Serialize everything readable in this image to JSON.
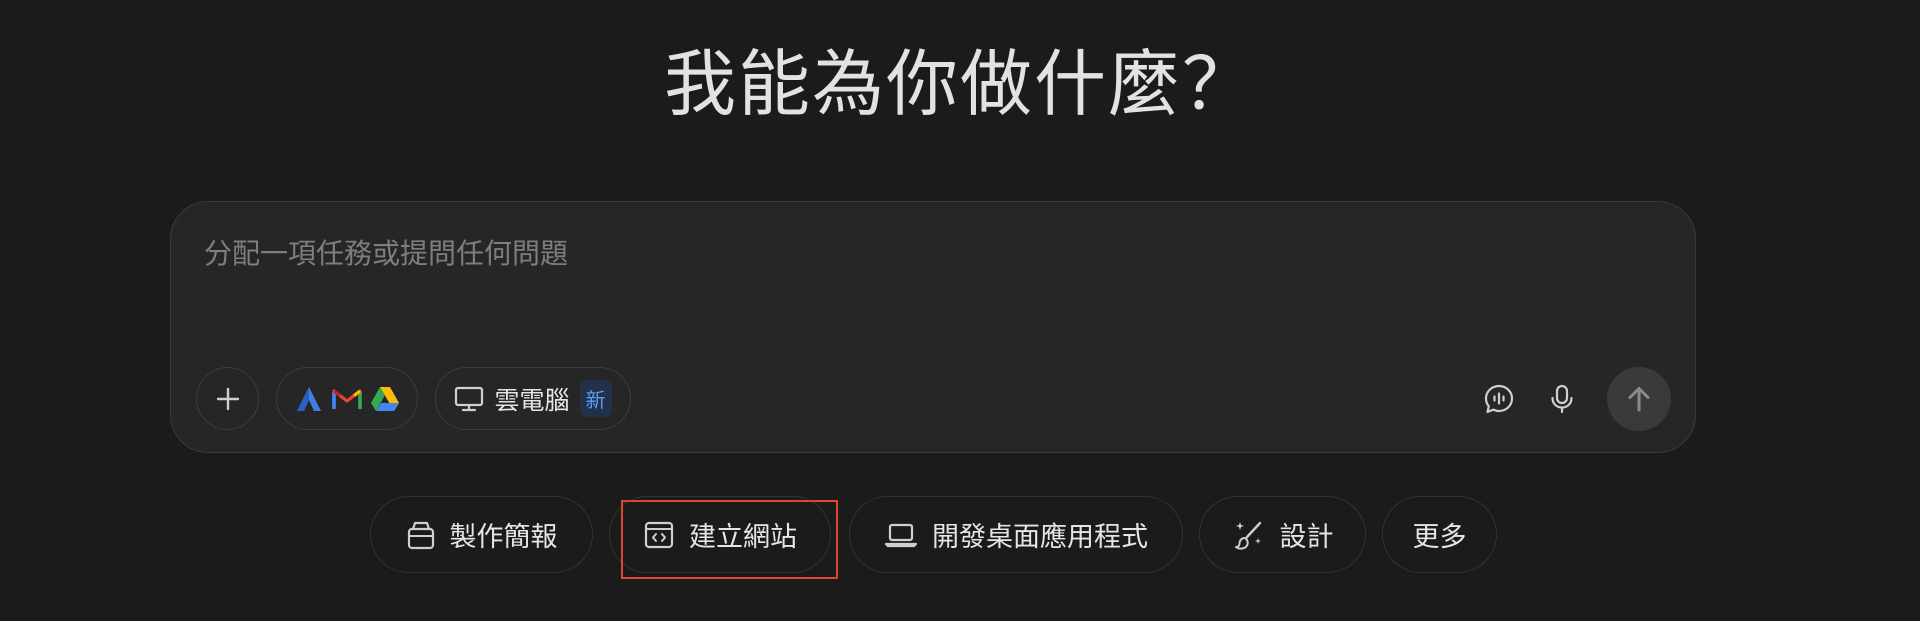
{
  "heading": {
    "title": "我能為你做什麼？"
  },
  "composer": {
    "placeholder": "分配一項任務或提問任何問題",
    "cloud_pc_label": "雲電腦",
    "new_badge": "新"
  },
  "actions": [
    {
      "label": "製作簡報",
      "icon": "bag-icon"
    },
    {
      "label": "建立網站",
      "icon": "code-window-icon"
    },
    {
      "label": "開發桌面應用程式",
      "icon": "laptop-icon"
    },
    {
      "label": "設計",
      "icon": "paint-brush-sparkle-icon"
    },
    {
      "label": "更多",
      "icon": ""
    }
  ],
  "colors": {
    "background": "#1b1b1b",
    "composer": "#262626",
    "highlight": "#e0452f",
    "badge_text": "#5e9cf4"
  }
}
